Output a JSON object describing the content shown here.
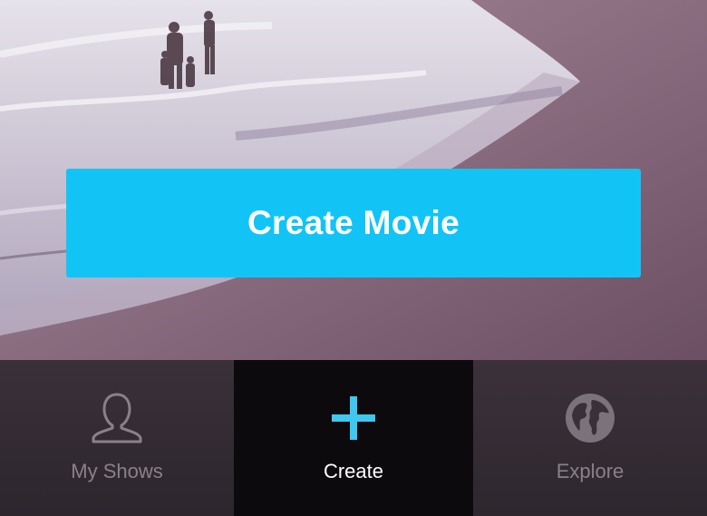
{
  "hero": {
    "primary_button_label": "Create Movie"
  },
  "tabbar": {
    "active": "Create",
    "tabs": [
      {
        "label": "My Shows",
        "icon": "person-icon"
      },
      {
        "label": "Create",
        "icon": "plus-icon"
      },
      {
        "label": "Explore",
        "icon": "globe-icon"
      }
    ]
  },
  "colors": {
    "accent": "#12c4f6",
    "tab_inactive_text": "#8a8089",
    "tab_active_bg": "#0d0a0d"
  }
}
